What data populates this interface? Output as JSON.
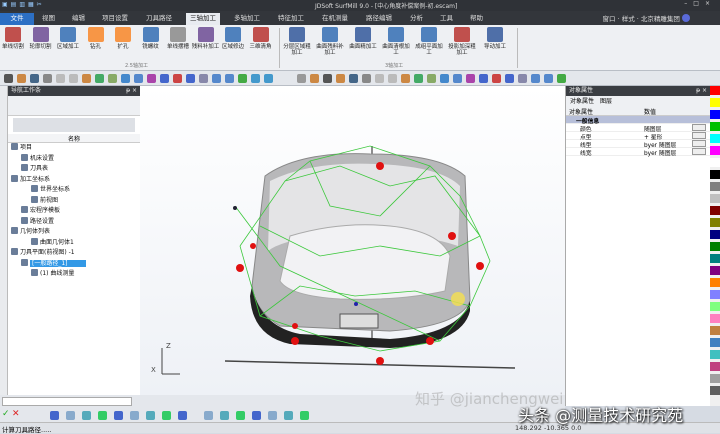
{
  "title": "JDSoft SurfMill 9.0 - [中心角度补偿案例-初.escam]",
  "menu": {
    "file": "文件",
    "tabs": [
      "视图",
      "编辑",
      "项目设置",
      "刀具路径",
      "三轴加工",
      "多轴加工",
      "特征加工",
      "在机测量",
      "路径编辑",
      "分析",
      "工具",
      "帮助"
    ],
    "active": "三轴加工",
    "window": "窗口",
    "style": "样式",
    "company": "北京精雕集团"
  },
  "ribbon": {
    "group1": "2.5轴加工",
    "group2": "3轴加工",
    "items1": [
      "单线切割",
      "轮廓切割",
      "区域加工",
      "钻孔",
      "扩孔",
      "铣螺纹",
      "单线摆槽",
      "残料补加工",
      "区域修边",
      "三维清角"
    ],
    "items2": [
      "分层区域粗加工",
      "曲面残料补加工",
      "曲面精加工",
      "曲面清根加工",
      "成组平面加工",
      "投影加深粗加工",
      "导动加工"
    ]
  },
  "nav": {
    "title": "导航工作条",
    "column": "名称",
    "tree": [
      "项目",
      "机床设置",
      "刀具表",
      "加工坐标系",
      "世界坐标系",
      "前视图",
      "宏程序模板",
      "路径设置",
      "几何体列表",
      "曲面几何体1",
      "刀具平面(前视图) -1",
      "[一般路径_1]",
      "(1) 曲线测量"
    ]
  },
  "props": {
    "title": "对象属性",
    "tabs": [
      "对象属性",
      "图层"
    ],
    "col1": "对象属性",
    "col2": "数值",
    "section": "一般信息",
    "rows": [
      {
        "k": "颜色",
        "v": "随图层"
      },
      {
        "k": "点型",
        "v": "+ 星形"
      },
      {
        "k": "线型",
        "v": "byer 随图层"
      },
      {
        "k": "线宽",
        "v": "byer 随图层"
      }
    ]
  },
  "palette": [
    "#ff0000",
    "#ffff00",
    "#0000ff",
    "#00c000",
    "#00ffff",
    "#ff00ff",
    "#ffffff",
    "#000000",
    "#808080",
    "#c0c0c0",
    "#800000",
    "#808000",
    "#000080",
    "#008000",
    "#008080",
    "#800080",
    "#ff8000",
    "#8080ff",
    "#80ff80",
    "#ff80c0",
    "#c08040",
    "#4080c0",
    "#40c0c0",
    "#c04080",
    "#a0a0a0",
    "#606060"
  ],
  "status": {
    "text": "计算刀具路径.....",
    "coords": "148.292 -10.365 0.0"
  },
  "axis": {
    "z": "Z",
    "x": "X"
  },
  "watermarks": {
    "toutiao": "头条 @测量技术研究苑",
    "zhihu": "知乎 @jianchengwei"
  }
}
